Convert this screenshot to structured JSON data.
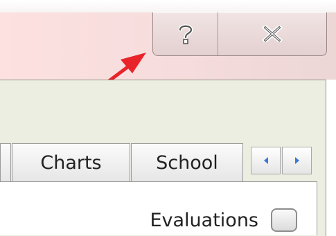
{
  "window": {
    "help_button": {
      "icon": "help-icon",
      "glyph": "?"
    },
    "close_button": {
      "icon": "close-icon"
    }
  },
  "annotation": {
    "arrow_color": "#e8232a"
  },
  "tabs": [
    {
      "label": "Charts"
    },
    {
      "label": "School"
    }
  ],
  "tab_scroll": {
    "left_icon": "scroll-left-icon",
    "right_icon": "scroll-right-icon",
    "accent_color": "#3b78d8"
  },
  "panel": {
    "evaluations_label": "Evaluations",
    "evaluations_checked": false
  }
}
